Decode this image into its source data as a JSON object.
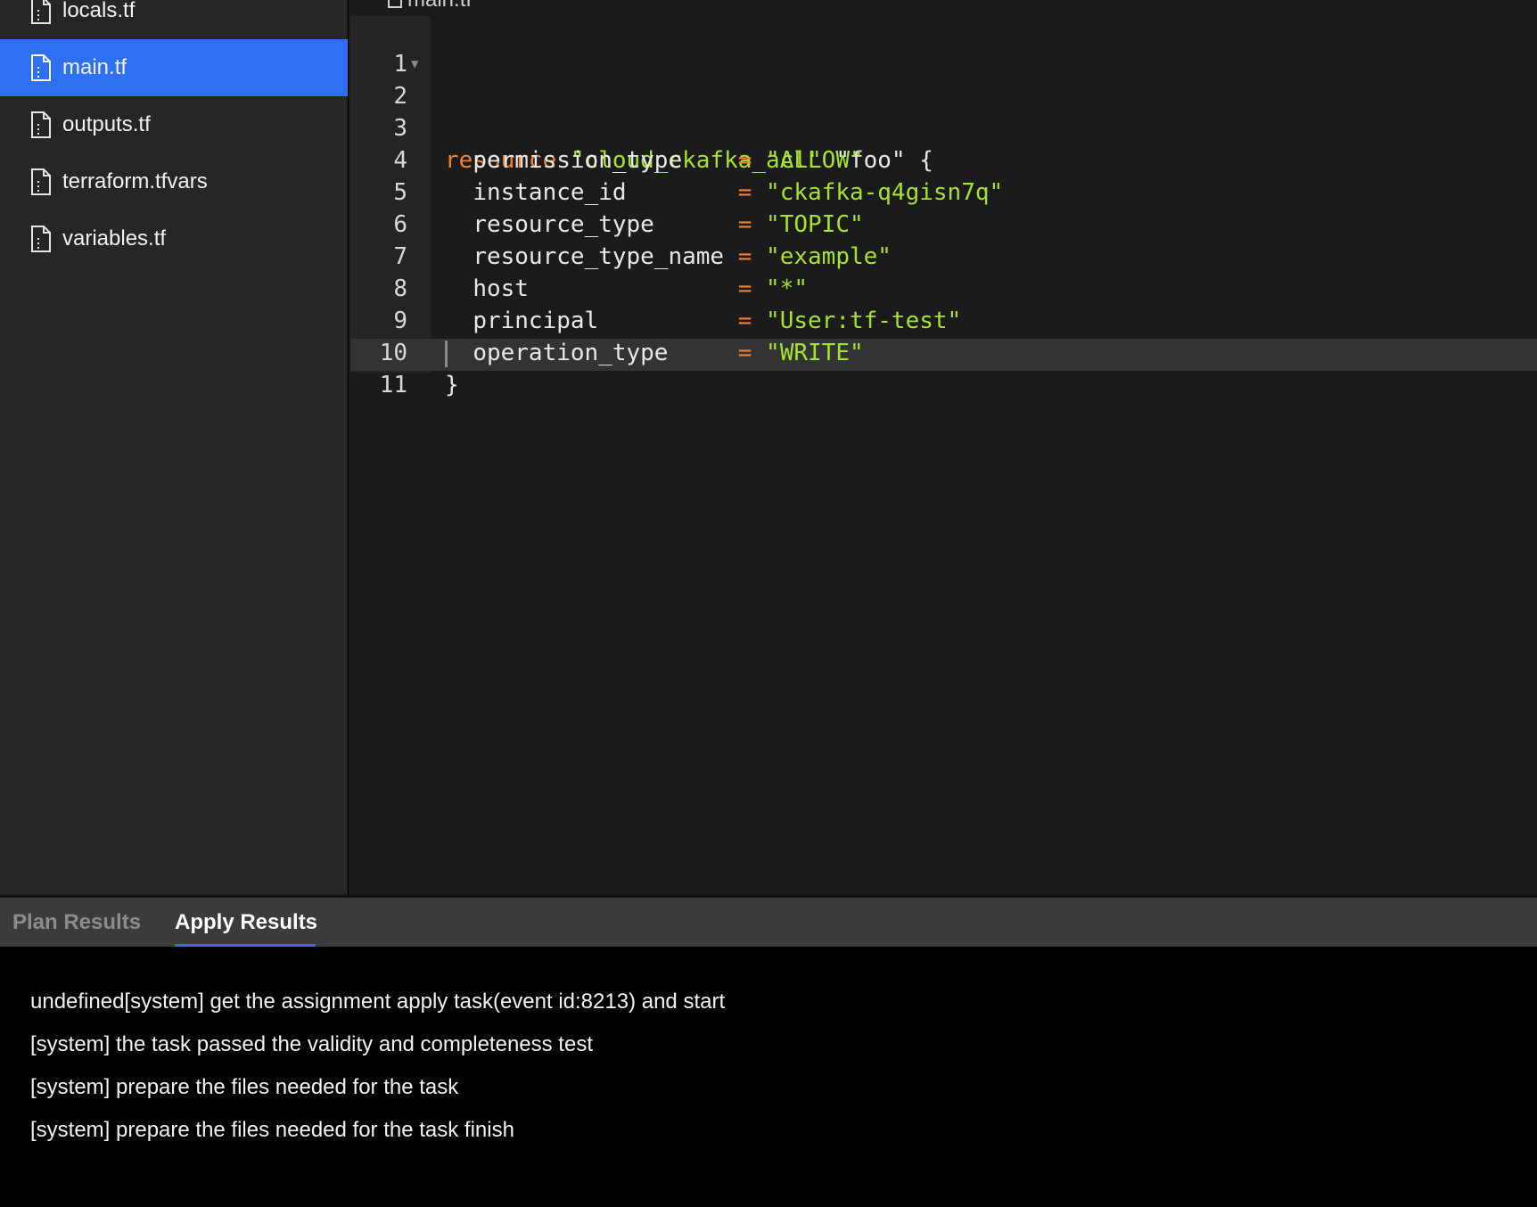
{
  "sidebar": {
    "files": [
      {
        "name": "locals.tf",
        "active": false
      },
      {
        "name": "main.tf",
        "active": true
      },
      {
        "name": "outputs.tf",
        "active": false
      },
      {
        "name": "terraform.tfvars",
        "active": false
      },
      {
        "name": "variables.tf",
        "active": false
      }
    ]
  },
  "editor": {
    "tab_title": "main.tf",
    "line_numbers": [
      "1",
      "2",
      "3",
      "4",
      "5",
      "6",
      "7",
      "8",
      "9",
      "10",
      "11"
    ],
    "code": {
      "l2_kw": "resource",
      "l2_type": "\"cloud_ckafka_acl\"",
      "l2_name": "\"foo\"",
      "l2_brace": "{",
      "l3_key": "permission_type    ",
      "l3_val": "\"ALLOW\"",
      "l4_key": "instance_id        ",
      "l4_val": "\"ckafka-q4gisn7q\"",
      "l5_key": "resource_type      ",
      "l5_val": "\"TOPIC\"",
      "l6_key": "resource_type_name ",
      "l6_val": "\"example\"",
      "l7_key": "host               ",
      "l7_val": "\"*\"",
      "l8_key": "principal          ",
      "l8_val": "\"User:tf-test\"",
      "l9_key": "operation_type     ",
      "l9_val": "\"WRITE\"",
      "l10_brace": "}",
      "eq": "="
    }
  },
  "results": {
    "tabs": [
      {
        "label": "Plan Results",
        "active": false
      },
      {
        "label": "Apply Results",
        "active": true
      }
    ],
    "log": [
      "undefined[system] get the assignment apply task(event id:8213) and start",
      "[system] the task passed the validity and completeness test",
      "[system] prepare the files needed for the task",
      "[system] prepare the files needed for the task finish"
    ]
  },
  "colors": {
    "accent": "#2f6ff3",
    "keyword": "#f08231",
    "string": "#a6e22e"
  }
}
